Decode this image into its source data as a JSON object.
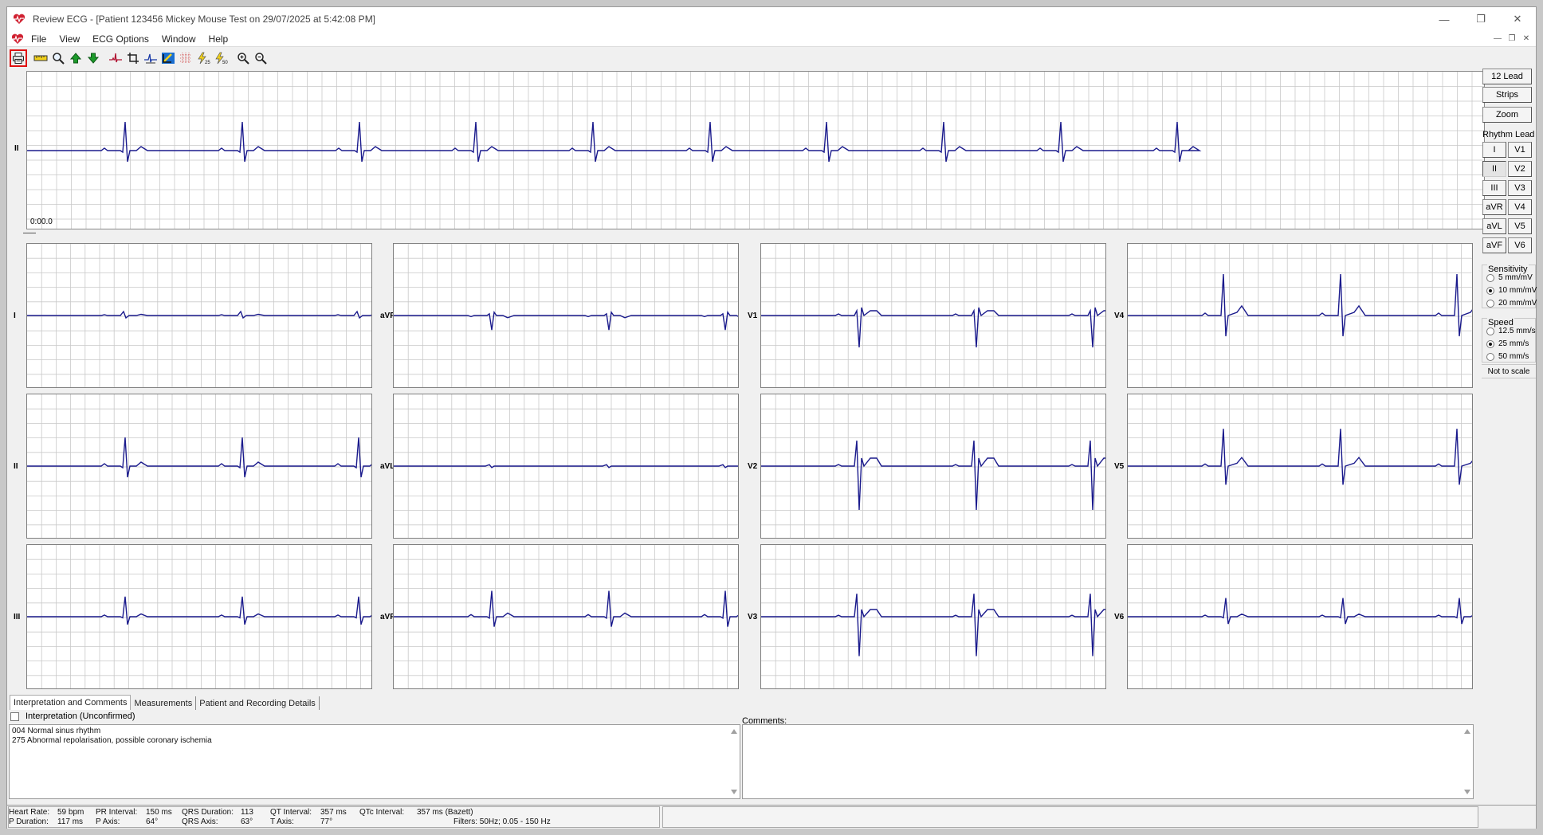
{
  "window": {
    "title": "Review ECG - [Patient 123456 Mickey Mouse Test on 29/07/2025 at 5:42:08 PM]",
    "minimize": "—",
    "maximize": "❐",
    "close": "✕"
  },
  "menu": {
    "items": [
      "File",
      "View",
      "ECG Options",
      "Window",
      "Help"
    ]
  },
  "toolbar": {
    "tools": [
      "print-icon",
      "ruler-icon",
      "magnifier-icon",
      "arrow-up-icon",
      "arrow-down-icon",
      "waveform-icon",
      "crop-icon",
      "measure-beat-icon",
      "caliper-icon",
      "grid-icon",
      "lightning-25-icon",
      "lightning-50-icon",
      "zoom-in-icon",
      "zoom-out-icon"
    ]
  },
  "rhythm": {
    "lead": "II",
    "time_label": "0:00.0"
  },
  "leads": [
    "I",
    "aVR",
    "V1",
    "V4",
    "II",
    "aVL",
    "V2",
    "V5",
    "III",
    "aVF",
    "V3",
    "V6"
  ],
  "side": {
    "btn_12lead": "12 Lead",
    "btn_strips": "Strips",
    "btn_zoom": "Zoom",
    "rhythm_lead_title": "Rhythm Lead",
    "rhythm_leads": [
      "I",
      "V1",
      "II",
      "V2",
      "III",
      "V3",
      "aVR",
      "V4",
      "aVL",
      "V5",
      "aVF",
      "V6"
    ],
    "sensitivity_title": "Sensitivity",
    "sensitivity_options": [
      "5 mm/mV",
      "10 mm/mV",
      "20 mm/mV"
    ],
    "speed_title": "Speed",
    "speed_options": [
      "12.5 mm/s",
      "25 mm/s",
      "50 mm/s"
    ],
    "not_to_scale": "Not to scale"
  },
  "tabs": [
    "Interpretation and Comments",
    "Measurements",
    "Patient and Recording Details"
  ],
  "interpretation": {
    "checkbox_label": "Interpretation (Unconfirmed)",
    "lines": [
      "004 Normal sinus rhythm",
      "275 Abnormal repolarisation, possible coronary ischemia"
    ],
    "comments_label": "Comments:"
  },
  "status": {
    "heart_rate_label": "Heart Rate:",
    "heart_rate": "59 bpm",
    "p_duration_label": "P Duration:",
    "p_duration": "117 ms",
    "pr_label": "PR Interval:",
    "pr": "150 ms",
    "p_axis_label": "P Axis:",
    "p_axis": "64°",
    "qrs_dur_label": "QRS Duration:",
    "qrs_dur": "113",
    "qrs_axis_label": "QRS Axis:",
    "qrs_axis": "63°",
    "qt_label": "QT Interval:",
    "qt": "357 ms",
    "t_axis_label": "T Axis:",
    "t_axis": "77°",
    "qtc_label": "QTc Interval:",
    "qtc": "357 ms (Bazett)",
    "filters": "Filters: 50Hz; 0.05 - 150 Hz"
  }
}
